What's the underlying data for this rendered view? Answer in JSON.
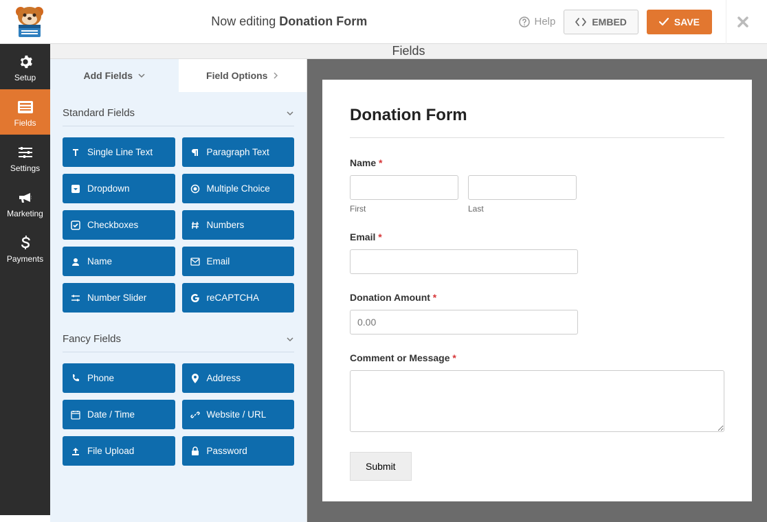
{
  "header": {
    "editing_prefix": "Now editing ",
    "form_name": "Donation Form",
    "help_label": "Help",
    "embed_label": "EMBED",
    "save_label": "SAVE"
  },
  "sidebar": {
    "items": [
      {
        "label": "Setup",
        "icon": "gear"
      },
      {
        "label": "Fields",
        "icon": "form"
      },
      {
        "label": "Settings",
        "icon": "sliders"
      },
      {
        "label": "Marketing",
        "icon": "bullhorn"
      },
      {
        "label": "Payments",
        "icon": "dollar"
      }
    ]
  },
  "section_heading": "Fields",
  "panel": {
    "tabs": {
      "add": "Add Fields",
      "options": "Field Options"
    },
    "standard_title": "Standard Fields",
    "fancy_title": "Fancy Fields",
    "standard": [
      "Single Line Text",
      "Paragraph Text",
      "Dropdown",
      "Multiple Choice",
      "Checkboxes",
      "Numbers",
      "Name",
      "Email",
      "Number Slider",
      "reCAPTCHA"
    ],
    "fancy": [
      "Phone",
      "Address",
      "Date / Time",
      "Website / URL",
      "File Upload",
      "Password"
    ]
  },
  "preview": {
    "title": "Donation Form",
    "name_label": "Name",
    "first_sub": "First",
    "last_sub": "Last",
    "email_label": "Email",
    "amount_label": "Donation Amount",
    "amount_placeholder": "0.00",
    "comment_label": "Comment or Message",
    "submit_label": "Submit"
  }
}
